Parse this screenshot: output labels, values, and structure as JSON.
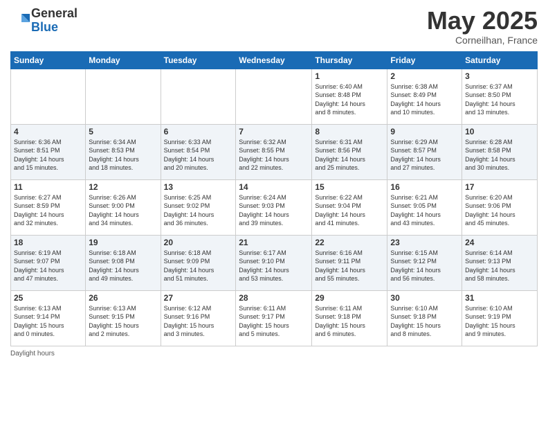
{
  "header": {
    "logo_general": "General",
    "logo_blue": "Blue",
    "month_title": "May 2025",
    "location": "Corneilhan, France"
  },
  "footer": {
    "daylight_label": "Daylight hours"
  },
  "weekdays": [
    "Sunday",
    "Monday",
    "Tuesday",
    "Wednesday",
    "Thursday",
    "Friday",
    "Saturday"
  ],
  "weeks": [
    [
      {
        "day": "",
        "info": ""
      },
      {
        "day": "",
        "info": ""
      },
      {
        "day": "",
        "info": ""
      },
      {
        "day": "",
        "info": ""
      },
      {
        "day": "1",
        "info": "Sunrise: 6:40 AM\nSunset: 8:48 PM\nDaylight: 14 hours\nand 8 minutes."
      },
      {
        "day": "2",
        "info": "Sunrise: 6:38 AM\nSunset: 8:49 PM\nDaylight: 14 hours\nand 10 minutes."
      },
      {
        "day": "3",
        "info": "Sunrise: 6:37 AM\nSunset: 8:50 PM\nDaylight: 14 hours\nand 13 minutes."
      }
    ],
    [
      {
        "day": "4",
        "info": "Sunrise: 6:36 AM\nSunset: 8:51 PM\nDaylight: 14 hours\nand 15 minutes."
      },
      {
        "day": "5",
        "info": "Sunrise: 6:34 AM\nSunset: 8:53 PM\nDaylight: 14 hours\nand 18 minutes."
      },
      {
        "day": "6",
        "info": "Sunrise: 6:33 AM\nSunset: 8:54 PM\nDaylight: 14 hours\nand 20 minutes."
      },
      {
        "day": "7",
        "info": "Sunrise: 6:32 AM\nSunset: 8:55 PM\nDaylight: 14 hours\nand 22 minutes."
      },
      {
        "day": "8",
        "info": "Sunrise: 6:31 AM\nSunset: 8:56 PM\nDaylight: 14 hours\nand 25 minutes."
      },
      {
        "day": "9",
        "info": "Sunrise: 6:29 AM\nSunset: 8:57 PM\nDaylight: 14 hours\nand 27 minutes."
      },
      {
        "day": "10",
        "info": "Sunrise: 6:28 AM\nSunset: 8:58 PM\nDaylight: 14 hours\nand 30 minutes."
      }
    ],
    [
      {
        "day": "11",
        "info": "Sunrise: 6:27 AM\nSunset: 8:59 PM\nDaylight: 14 hours\nand 32 minutes."
      },
      {
        "day": "12",
        "info": "Sunrise: 6:26 AM\nSunset: 9:00 PM\nDaylight: 14 hours\nand 34 minutes."
      },
      {
        "day": "13",
        "info": "Sunrise: 6:25 AM\nSunset: 9:02 PM\nDaylight: 14 hours\nand 36 minutes."
      },
      {
        "day": "14",
        "info": "Sunrise: 6:24 AM\nSunset: 9:03 PM\nDaylight: 14 hours\nand 39 minutes."
      },
      {
        "day": "15",
        "info": "Sunrise: 6:22 AM\nSunset: 9:04 PM\nDaylight: 14 hours\nand 41 minutes."
      },
      {
        "day": "16",
        "info": "Sunrise: 6:21 AM\nSunset: 9:05 PM\nDaylight: 14 hours\nand 43 minutes."
      },
      {
        "day": "17",
        "info": "Sunrise: 6:20 AM\nSunset: 9:06 PM\nDaylight: 14 hours\nand 45 minutes."
      }
    ],
    [
      {
        "day": "18",
        "info": "Sunrise: 6:19 AM\nSunset: 9:07 PM\nDaylight: 14 hours\nand 47 minutes."
      },
      {
        "day": "19",
        "info": "Sunrise: 6:18 AM\nSunset: 9:08 PM\nDaylight: 14 hours\nand 49 minutes."
      },
      {
        "day": "20",
        "info": "Sunrise: 6:18 AM\nSunset: 9:09 PM\nDaylight: 14 hours\nand 51 minutes."
      },
      {
        "day": "21",
        "info": "Sunrise: 6:17 AM\nSunset: 9:10 PM\nDaylight: 14 hours\nand 53 minutes."
      },
      {
        "day": "22",
        "info": "Sunrise: 6:16 AM\nSunset: 9:11 PM\nDaylight: 14 hours\nand 55 minutes."
      },
      {
        "day": "23",
        "info": "Sunrise: 6:15 AM\nSunset: 9:12 PM\nDaylight: 14 hours\nand 56 minutes."
      },
      {
        "day": "24",
        "info": "Sunrise: 6:14 AM\nSunset: 9:13 PM\nDaylight: 14 hours\nand 58 minutes."
      }
    ],
    [
      {
        "day": "25",
        "info": "Sunrise: 6:13 AM\nSunset: 9:14 PM\nDaylight: 15 hours\nand 0 minutes."
      },
      {
        "day": "26",
        "info": "Sunrise: 6:13 AM\nSunset: 9:15 PM\nDaylight: 15 hours\nand 2 minutes."
      },
      {
        "day": "27",
        "info": "Sunrise: 6:12 AM\nSunset: 9:16 PM\nDaylight: 15 hours\nand 3 minutes."
      },
      {
        "day": "28",
        "info": "Sunrise: 6:11 AM\nSunset: 9:17 PM\nDaylight: 15 hours\nand 5 minutes."
      },
      {
        "day": "29",
        "info": "Sunrise: 6:11 AM\nSunset: 9:18 PM\nDaylight: 15 hours\nand 6 minutes."
      },
      {
        "day": "30",
        "info": "Sunrise: 6:10 AM\nSunset: 9:18 PM\nDaylight: 15 hours\nand 8 minutes."
      },
      {
        "day": "31",
        "info": "Sunrise: 6:10 AM\nSunset: 9:19 PM\nDaylight: 15 hours\nand 9 minutes."
      }
    ]
  ]
}
